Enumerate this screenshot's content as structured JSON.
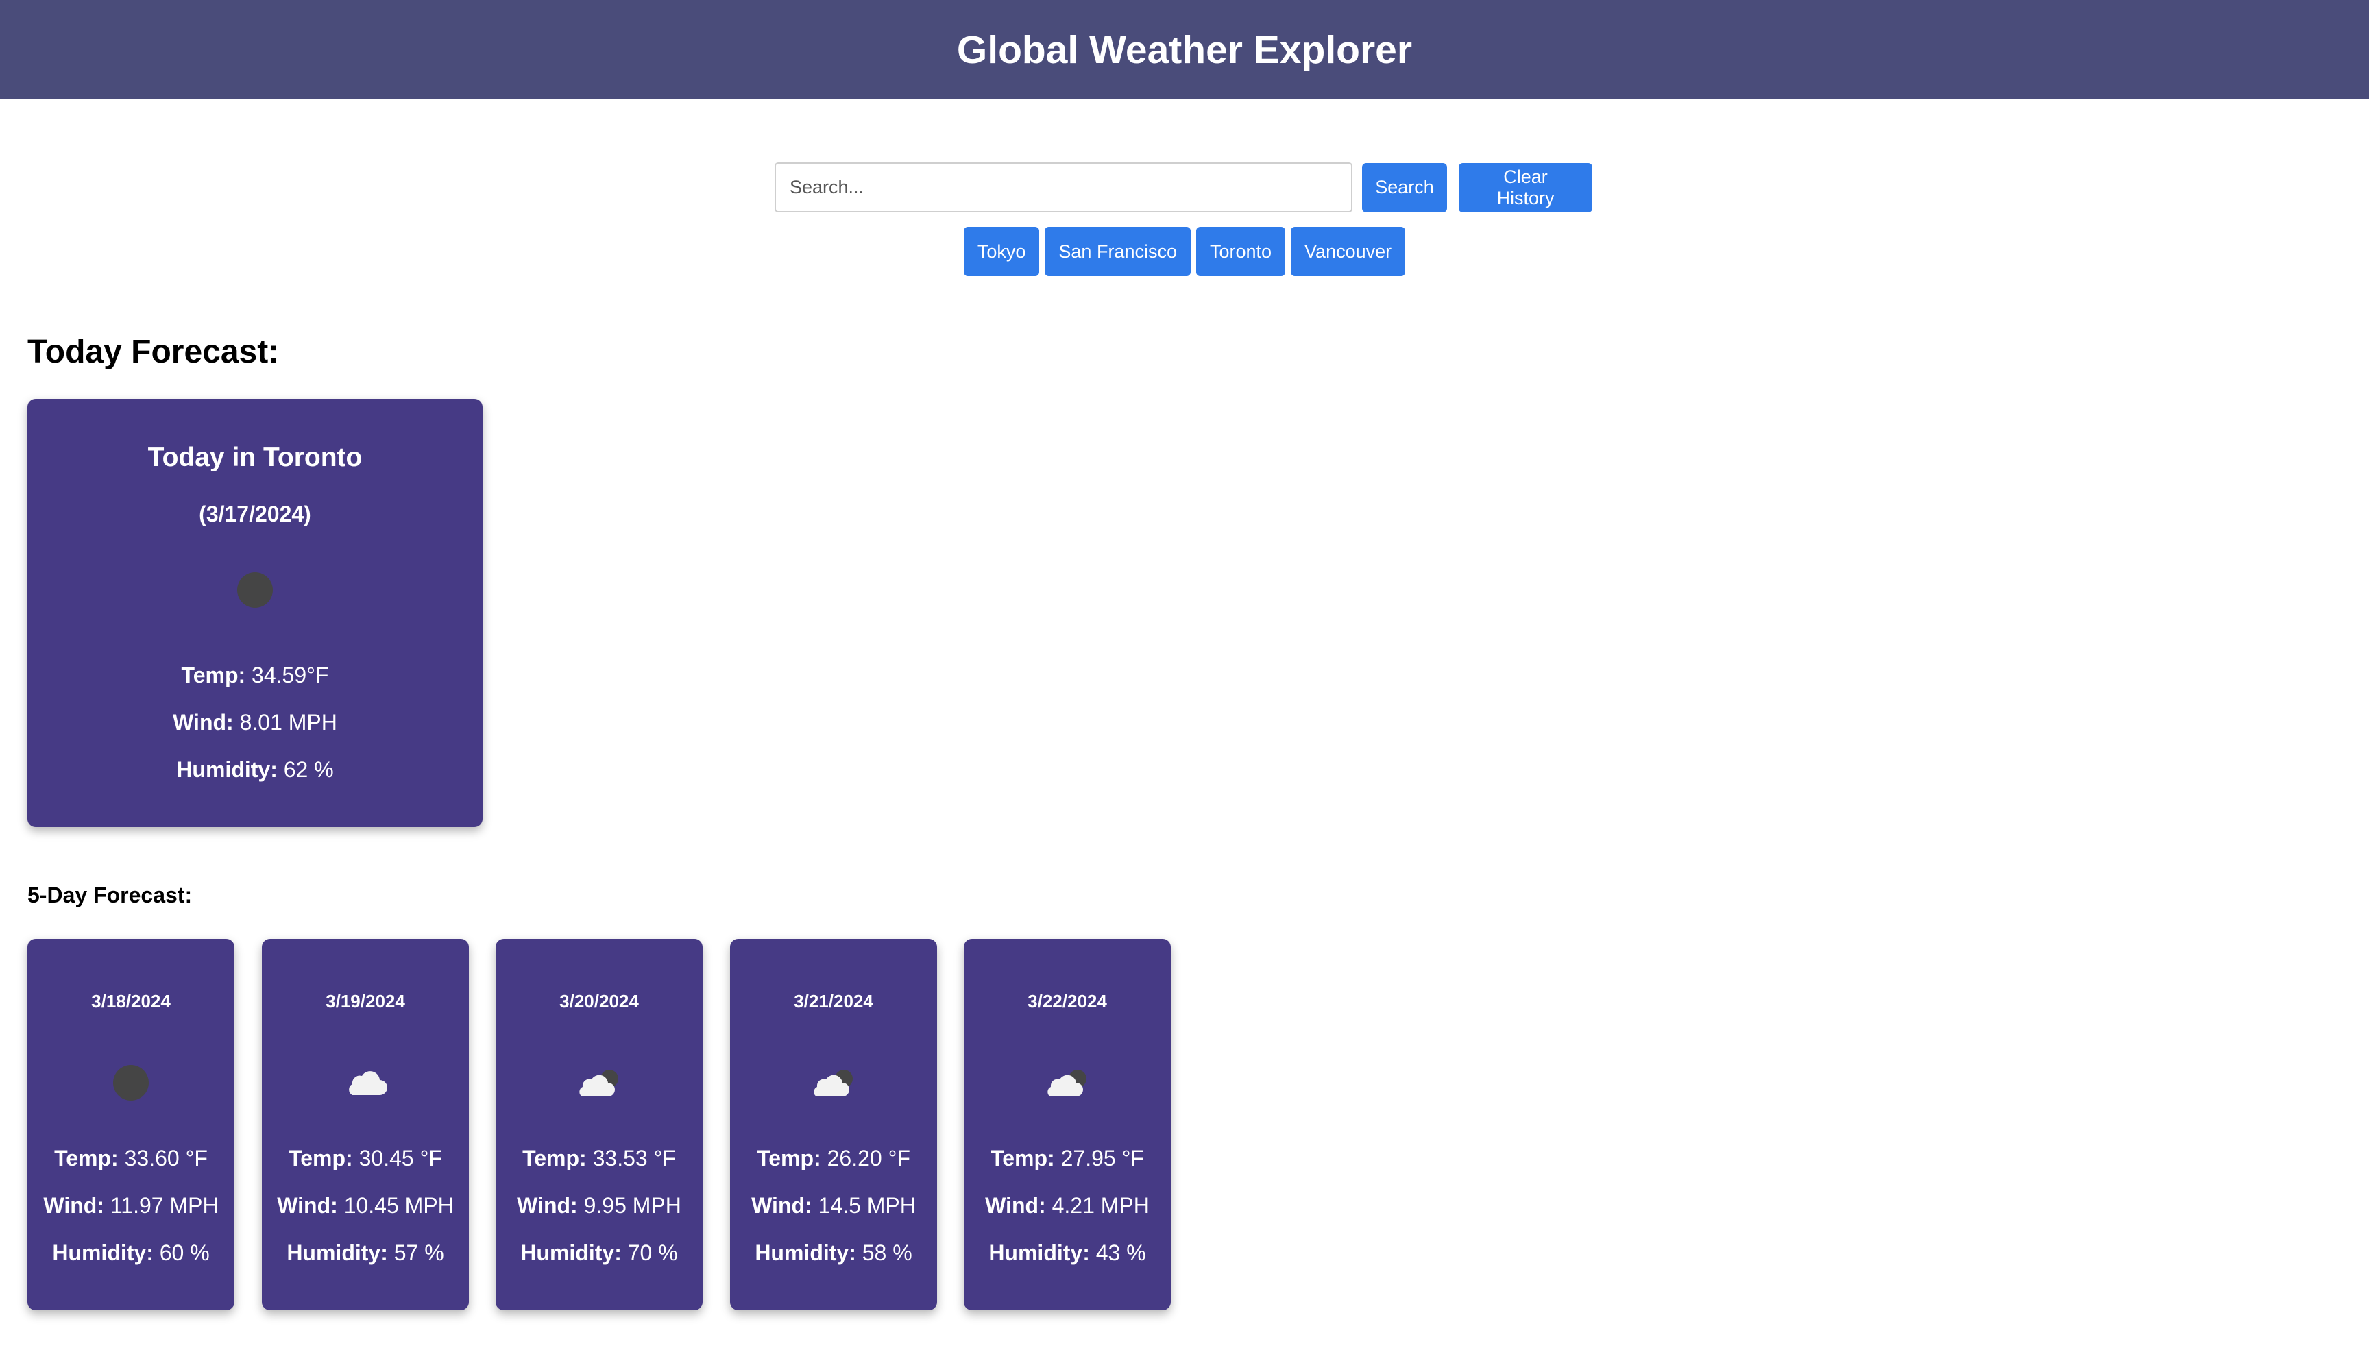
{
  "header": {
    "title": "Global Weather Explorer"
  },
  "search": {
    "placeholder": "Search...",
    "value": "",
    "search_label": "Search",
    "clear_label": "Clear History"
  },
  "history": [
    "Tokyo",
    "San Francisco",
    "Toronto",
    "Vancouver"
  ],
  "today": {
    "section_title": "Today Forecast:",
    "city_line": "Today in Toronto",
    "date": "(3/17/2024)",
    "icon": "night-moon-icon",
    "temp_label": "Temp:",
    "temp": "34.59°F",
    "wind_label": "Wind:",
    "wind": "8.01 MPH",
    "humidity_label": "Humidity:",
    "humidity": "62 %"
  },
  "five_day": {
    "section_title": "5-Day Forecast:",
    "labels": {
      "temp": "Temp:",
      "wind": "Wind:",
      "humidity": "Humidity:"
    },
    "days": [
      {
        "date": "3/18/2024",
        "icon": "night-moon-icon",
        "temp": "33.60 °F",
        "wind": "11.97 MPH",
        "humidity": "60 %"
      },
      {
        "date": "3/19/2024",
        "icon": "cloud-icon",
        "temp": "30.45 °F",
        "wind": "10.45 MPH",
        "humidity": "57 %"
      },
      {
        "date": "3/20/2024",
        "icon": "cloud-night-icon",
        "temp": "33.53 °F",
        "wind": "9.95 MPH",
        "humidity": "70 %"
      },
      {
        "date": "3/21/2024",
        "icon": "cloud-night-icon",
        "temp": "26.20 °F",
        "wind": "14.5 MPH",
        "humidity": "58 %"
      },
      {
        "date": "3/22/2024",
        "icon": "cloud-night-icon",
        "temp": "27.95 °F",
        "wind": "4.21 MPH",
        "humidity": "43 %"
      }
    ]
  },
  "colors": {
    "header_bg": "#4a4c7a",
    "card_bg": "#463a85",
    "button_bg": "#2f7bea"
  }
}
